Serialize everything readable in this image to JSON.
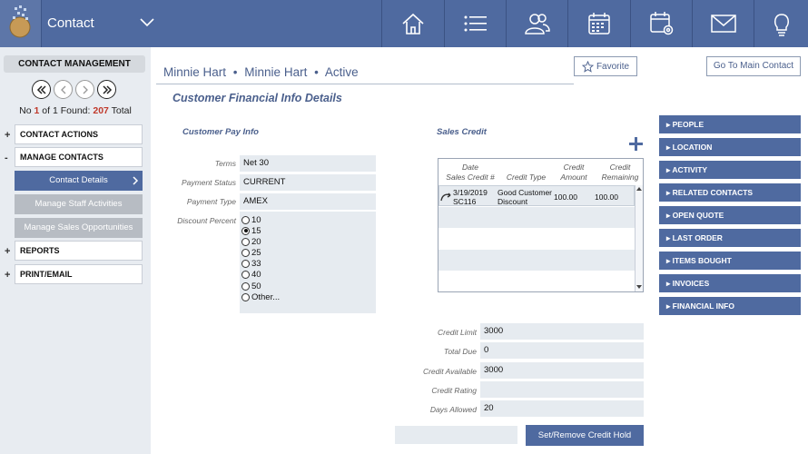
{
  "app": {
    "title": "Contact"
  },
  "topnav": [
    "home-icon",
    "list-icon",
    "people-icon",
    "calendar-icon",
    "calendar-settings-icon",
    "mail-icon",
    "lightbulb-icon"
  ],
  "sidebar": {
    "header": "CONTACT MANAGEMENT",
    "found": {
      "prefix": "No",
      "current": "1",
      "of": "of",
      "total": "1",
      "label": "Found:",
      "count": "207",
      "suffix": "Total"
    },
    "contact_actions": "CONTACT ACTIONS",
    "manage_contacts": "MANAGE CONTACTS",
    "contact_details": "Contact Details",
    "manage_staff": "Manage Staff Activities",
    "manage_sales": "Manage Sales Opportunities",
    "reports": "REPORTS",
    "print_email": "PRINT/EMAIL"
  },
  "header": {
    "first_name": "Minnie Hart",
    "sep1": "•",
    "company": "Minnie Hart",
    "sep2": "•",
    "status": "Active",
    "favorite": "Favorite",
    "main_contact": "Go To Main Contact"
  },
  "page": {
    "title": "Customer Financial Info Details"
  },
  "pay_info": {
    "section": "Customer Pay Info",
    "terms_label": "Terms",
    "terms": "Net 30",
    "status_label": "Payment Status",
    "status": "CURRENT",
    "type_label": "Payment Type",
    "type": "AMEX",
    "discount_label": "Discount Percent",
    "discount_options": [
      "10",
      "15",
      "20",
      "25",
      "33",
      "40",
      "50",
      "Other..."
    ],
    "discount_selected": "15"
  },
  "sales_credit": {
    "section": "Sales Credit",
    "headers": {
      "date": "Date",
      "credit_num": "Sales Credit #",
      "credit_type": "Credit Type",
      "amount_1": "Credit",
      "amount_2": "Amount",
      "remaining_1": "Credit",
      "remaining_2": "Remaining"
    },
    "rows": [
      {
        "date": "3/19/2019",
        "number": "SC116",
        "type_1": "Good Customer",
        "type_2": "Discount",
        "amount": "100.00",
        "remaining": "100.00"
      }
    ]
  },
  "credit": {
    "limit_label": "Credit Limit",
    "limit": "3000",
    "due_label": "Total Due",
    "due": "0",
    "available_label": "Credit Available",
    "available": "3000",
    "rating_label": "Credit Rating",
    "rating": "",
    "days_label": "Days Allowed",
    "days": "20"
  },
  "right_menu": [
    "PEOPLE",
    "LOCATION",
    "ACTIVITY",
    "RELATED CONTACTS",
    "OPEN QUOTE",
    "LAST ORDER",
    "ITEMS BOUGHT",
    "INVOICES",
    "FINANCIAL INFO"
  ],
  "hold_button": "Set/Remove Credit Hold",
  "colors": {
    "brand": "#4f6aa0",
    "sidebar": "#e8ecf1",
    "field": "#e6ebf0"
  }
}
